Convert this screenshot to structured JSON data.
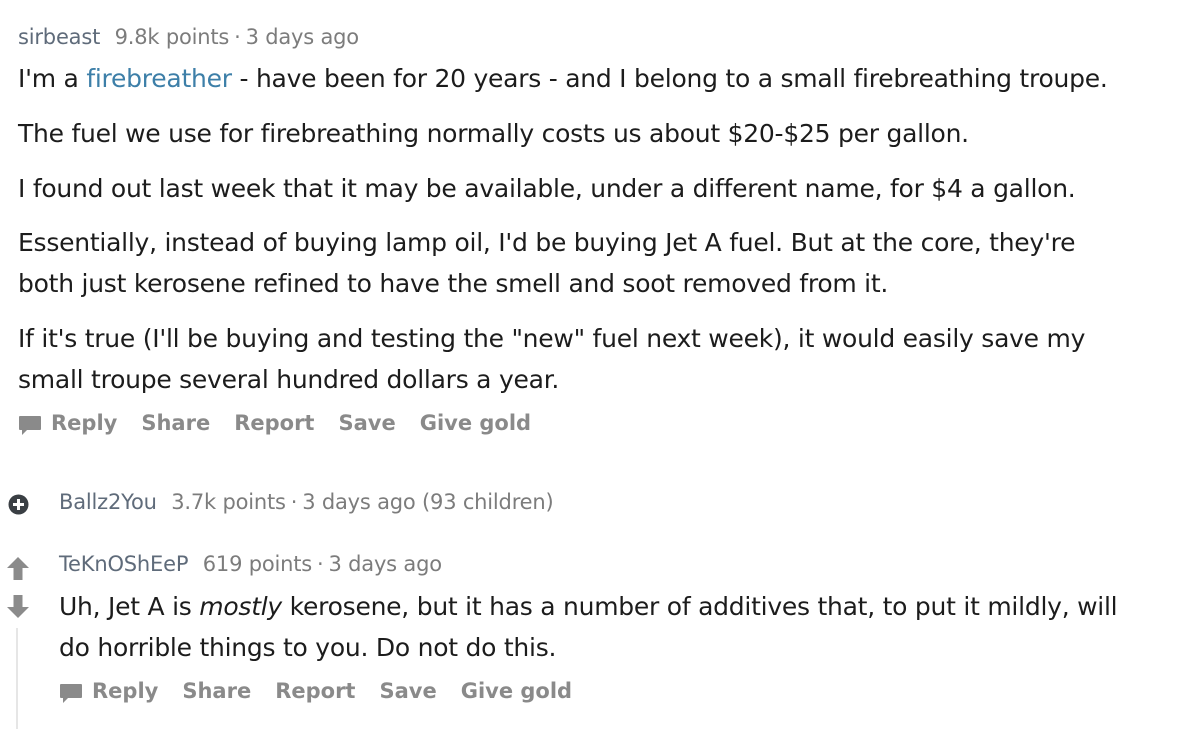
{
  "comment1": {
    "author": "sirbeast",
    "points": "9.8k points",
    "sep": "·",
    "time": "3 days ago",
    "line1_pre": "I'm a ",
    "line1_link": "firebreather",
    "line1_post": " - have been for 20 years - and I belong to a small firebreathing troupe.",
    "para2": "The fuel we use for firebreathing normally costs us about $20-$25 per gallon.",
    "para3": "I found out last week that it may be available, under a different name, for $4 a gallon.",
    "para4_line1": "Essentially, instead of buying lamp oil, I'd be buying Jet A fuel. But at the core, they're",
    "para4_line2": "both just kerosene refined to have the smell and soot removed from it.",
    "para5_line1": "If it's true (I'll be buying and testing the \"new\" fuel next week), it would easily save my",
    "para5_line2": "small troupe several hundred dollars a year.",
    "actions": {
      "reply": "Reply",
      "share": "Share",
      "report": "Report",
      "save": "Save",
      "give_gold": "Give gold"
    }
  },
  "comment2": {
    "author": "Ballz2You",
    "points": "3.7k points",
    "sep": "·",
    "time": "3 days ago",
    "children": "(93 children)",
    "expand_icon": "plus-circle-icon"
  },
  "comment3": {
    "author": "TeKnOShEeP",
    "points": "619 points",
    "sep": "·",
    "time": "3 days ago",
    "line1_pre": "Uh, Jet A is ",
    "line1_em": "mostly",
    "line1_post": " kerosene, but it has a number of additives that, to put it mildly, will",
    "line2": "do horrible things to you. Do not do this.",
    "upvote_icon": "upvote-arrow-icon",
    "downvote_icon": "downvote-arrow-icon",
    "actions": {
      "reply": "Reply",
      "share": "Share",
      "report": "Report",
      "save": "Save",
      "give_gold": "Give gold"
    }
  },
  "colors": {
    "meta_gray": "#7c7c7c",
    "link_blue": "#3d7fa8",
    "action_gray": "#8a8a8a",
    "vote_gray": "#8b8b8b",
    "expand_dark": "#3a3f44"
  }
}
